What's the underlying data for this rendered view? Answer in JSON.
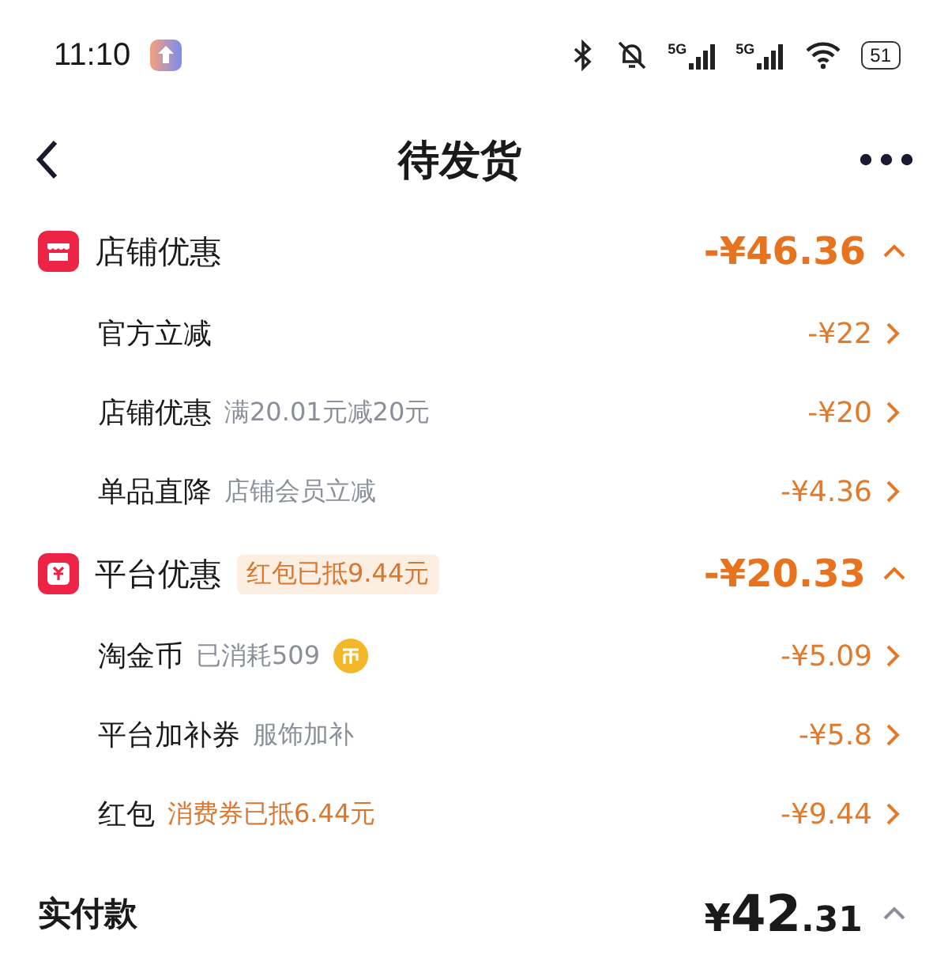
{
  "status_bar": {
    "time": "11:10",
    "network_1": "5G",
    "network_2": "5G",
    "battery": "51"
  },
  "nav": {
    "title": "待发货"
  },
  "sections": [
    {
      "title": "店铺优惠",
      "amount": "-¥46.36",
      "expanded": true,
      "items": [
        {
          "label": "官方立减",
          "coin": false,
          "amount": "-¥22"
        },
        {
          "label": "店铺优惠",
          "note": "满20.01元减20元",
          "highlighted": false,
          "coin": false,
          "amount": "-¥20"
        },
        {
          "label": "单品直降",
          "note": "店铺会员立减",
          "highlighted": false,
          "coin": false,
          "amount": "-¥4.36"
        }
      ]
    },
    {
      "title": "平台优惠",
      "tag": "红包已抵9.44元",
      "amount": "-¥20.33",
      "expanded": true,
      "items": [
        {
          "label": "淘金币",
          "note": "已消耗509",
          "highlighted": false,
          "coin": true,
          "amount": "-¥5.09"
        },
        {
          "label": "平台加补券",
          "note": "服饰加补",
          "highlighted": false,
          "coin": false,
          "amount": "-¥5.8"
        },
        {
          "label": "红包",
          "note": "消费券已抵6.44元",
          "highlighted": true,
          "coin": false,
          "amount": "-¥9.44"
        }
      ]
    }
  ],
  "total": {
    "label": "实付款",
    "currency": "¥",
    "whole": "42",
    "fraction": ".31",
    "expanded": false
  }
}
